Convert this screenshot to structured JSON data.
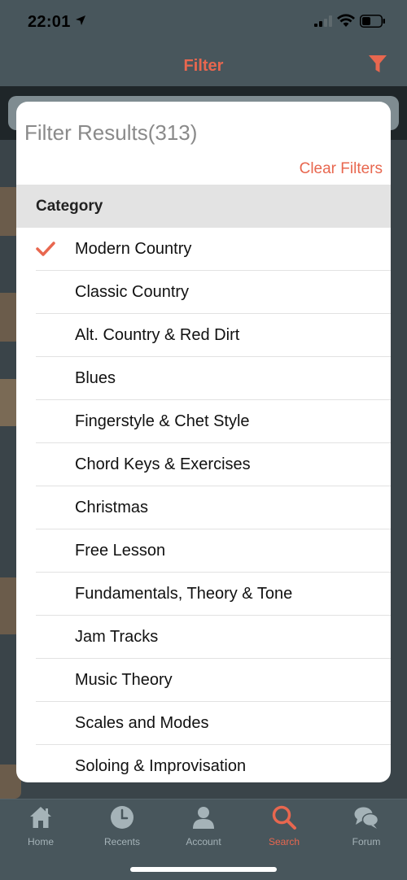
{
  "status_bar": {
    "time": "22:01"
  },
  "header": {
    "title": "Filter"
  },
  "modal": {
    "title": "Filter Results(313)",
    "clear_label": "Clear Filters",
    "section_label": "Category",
    "items": [
      {
        "label": "Modern Country",
        "selected": true
      },
      {
        "label": "Classic Country",
        "selected": false
      },
      {
        "label": "Alt. Country & Red Dirt",
        "selected": false
      },
      {
        "label": "Blues",
        "selected": false
      },
      {
        "label": "Fingerstyle & Chet Style",
        "selected": false
      },
      {
        "label": "Chord Keys & Exercises",
        "selected": false
      },
      {
        "label": "Christmas",
        "selected": false
      },
      {
        "label": "Free Lesson",
        "selected": false
      },
      {
        "label": "Fundamentals, Theory & Tone",
        "selected": false
      },
      {
        "label": "Jam Tracks",
        "selected": false
      },
      {
        "label": "Music Theory",
        "selected": false
      },
      {
        "label": "Scales and Modes",
        "selected": false
      },
      {
        "label": "Soloing & Improvisation",
        "selected": false
      }
    ]
  },
  "tabbar": {
    "tabs": [
      {
        "label": "Home",
        "icon": "home-icon"
      },
      {
        "label": "Recents",
        "icon": "clock-icon"
      },
      {
        "label": "Account",
        "icon": "person-icon"
      },
      {
        "label": "Search",
        "icon": "search-icon",
        "active": true
      },
      {
        "label": "Forum",
        "icon": "chat-bubbles-icon"
      }
    ]
  },
  "colors": {
    "accent": "#e8674f",
    "background": "#48565c",
    "tab_inactive": "#a5b3b8"
  }
}
